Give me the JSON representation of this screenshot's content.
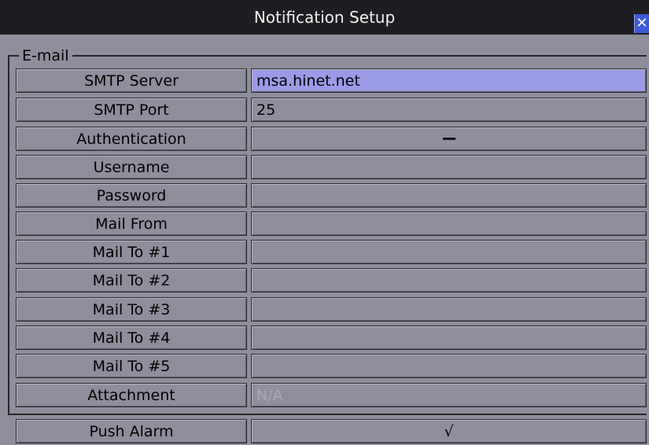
{
  "window": {
    "title": "Notification Setup",
    "close_icon": "close-icon"
  },
  "email_group": {
    "label": "E-mail",
    "rows": [
      {
        "label": "SMTP Server",
        "value": "msa.hinet.net",
        "selected": true
      },
      {
        "label": "SMTP Port",
        "value": "25"
      },
      {
        "label": "Authentication",
        "value": "dash"
      },
      {
        "label": "Username",
        "value": ""
      },
      {
        "label": "Password",
        "value": ""
      },
      {
        "label": "Mail From",
        "value": ""
      },
      {
        "label": "Mail To #1",
        "value": ""
      },
      {
        "label": "Mail To #2",
        "value": ""
      },
      {
        "label": "Mail To #3",
        "value": ""
      },
      {
        "label": "Mail To #4",
        "value": ""
      },
      {
        "label": "Mail To #5",
        "value": ""
      },
      {
        "label": "Attachment",
        "value": "N/A",
        "disabled": true
      }
    ]
  },
  "push_alarm": {
    "label": "Push Alarm",
    "value": "√"
  },
  "colors": {
    "background": "#8e8e9c",
    "titlebar": "#1e1e22",
    "selected_field": "#9b9be8",
    "close_button": "#3d5ad8"
  }
}
